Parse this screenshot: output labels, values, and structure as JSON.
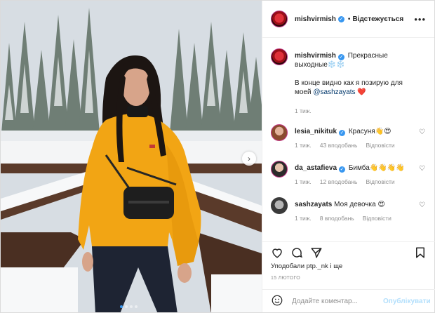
{
  "header": {
    "username": "mishvirmish",
    "follow_label": "Відстежується",
    "more_icon": "more-dots-icon"
  },
  "caption": {
    "username": "mishvirmish",
    "text_line1": "Прекрасные выходные❄️❄️",
    "text_line2": "В конце видно как я позирую для моей ",
    "mention": "@sashzayats",
    "emoji": "❤️",
    "time": "1 тиж."
  },
  "comments": [
    {
      "username": "lesia_nikituk",
      "text": "Красуня👋😍",
      "time": "1 тиж.",
      "likes": "43 вподобань",
      "reply": "Відповісти"
    },
    {
      "username": "da_astafieva",
      "text": "Бимба👋👋👋👋",
      "time": "1 тиж.",
      "likes": "12 вподобань",
      "reply": "Відповісти"
    },
    {
      "username": "sashzayats",
      "text": "Моя девочка 😍",
      "time": "1 тиж.",
      "likes": "8 вподобань",
      "reply": "Відповісти"
    }
  ],
  "likes_line": "Уподобали ptp._nk і ще",
  "date": "15 ЛЮТОГО",
  "composer": {
    "placeholder": "Додайте коментар...",
    "publish_label": "Опублікувати"
  },
  "colors": {
    "accent": "#3897f0",
    "sweater": "#f2a514",
    "heart": "#d00e2a"
  }
}
